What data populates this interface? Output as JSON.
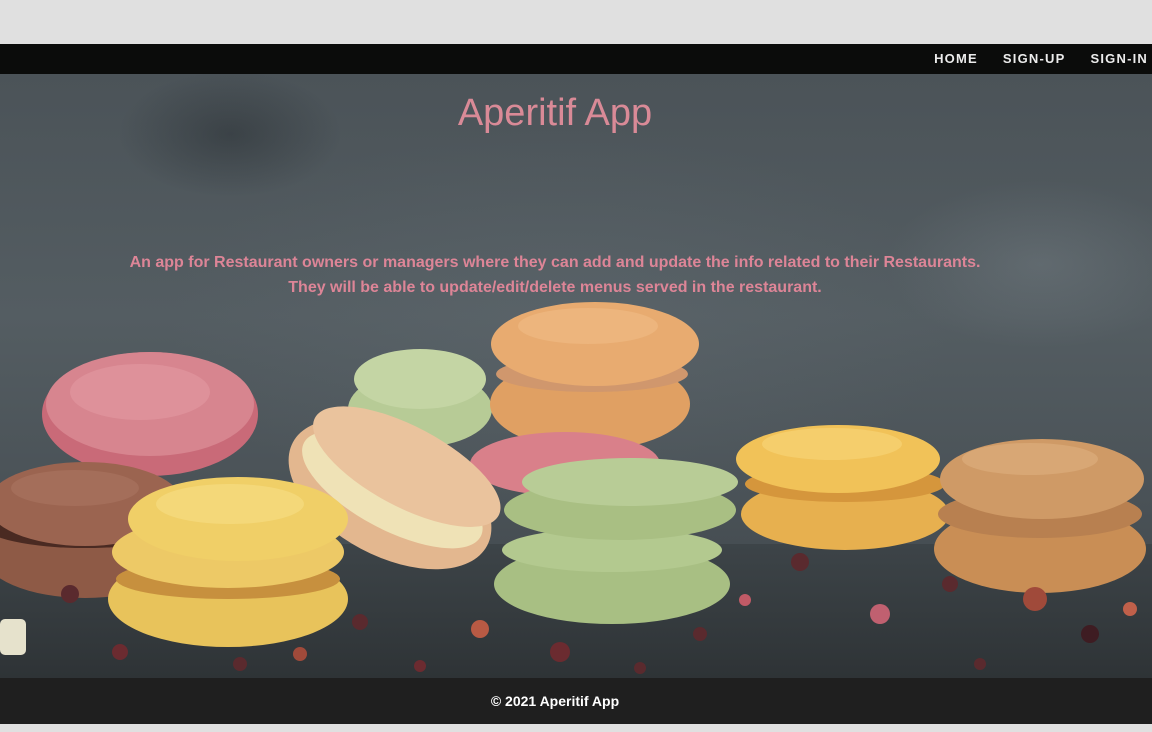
{
  "nav": {
    "links": [
      {
        "label": "HOME"
      },
      {
        "label": "SIGN-UP"
      },
      {
        "label": "SIGN-IN"
      }
    ]
  },
  "hero": {
    "title": "Aperitif App",
    "description_lines": [
      "An app for Restaurant owners or managers where they can add and update the info related to their Restaurants.",
      "They will be able to update/edit/delete menus served in the restaurant."
    ],
    "background_image": "macarons-photo"
  },
  "footer": {
    "copyright": "© 2021 Aperitif App"
  },
  "colors": {
    "navbar_bg": "#0b0c0b",
    "accent_pink": "#dd8597",
    "footer_bg": "#1f1f1f"
  }
}
